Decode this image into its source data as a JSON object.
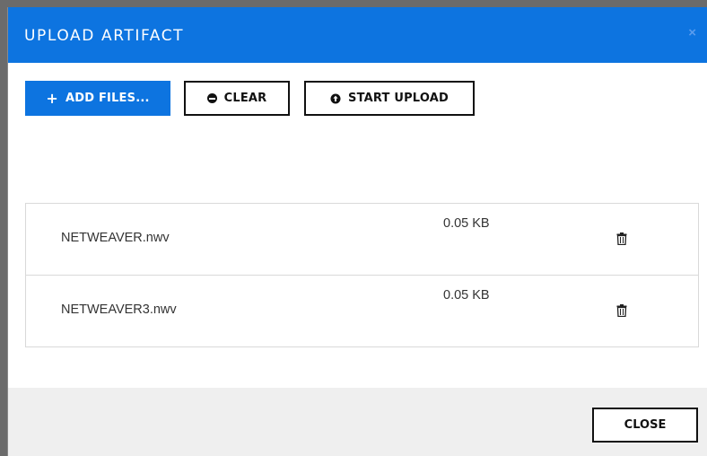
{
  "dialog": {
    "title": "UPLOAD ARTIFACT",
    "close_symbol": "×"
  },
  "toolbar": {
    "add_files": {
      "icon": "plus-icon",
      "icon_glyph": "+",
      "label": "ADD FILES..."
    },
    "clear": {
      "icon": "minus-circle-icon",
      "label": "CLEAR"
    },
    "start_upload": {
      "icon": "upload-circle-icon",
      "label": "START UPLOAD"
    }
  },
  "files": [
    {
      "name": "NETWEAVER.nwv",
      "size": "0.05 KB",
      "action_icon": "trash-icon"
    },
    {
      "name": "NETWEAVER3.nwv",
      "size": "0.05 KB",
      "action_icon": "trash-icon"
    }
  ],
  "footer": {
    "close_label": "CLOSE"
  },
  "colors": {
    "primary": "#0d74e0",
    "footer_bg": "#efefef",
    "border": "#d9d9d9"
  }
}
